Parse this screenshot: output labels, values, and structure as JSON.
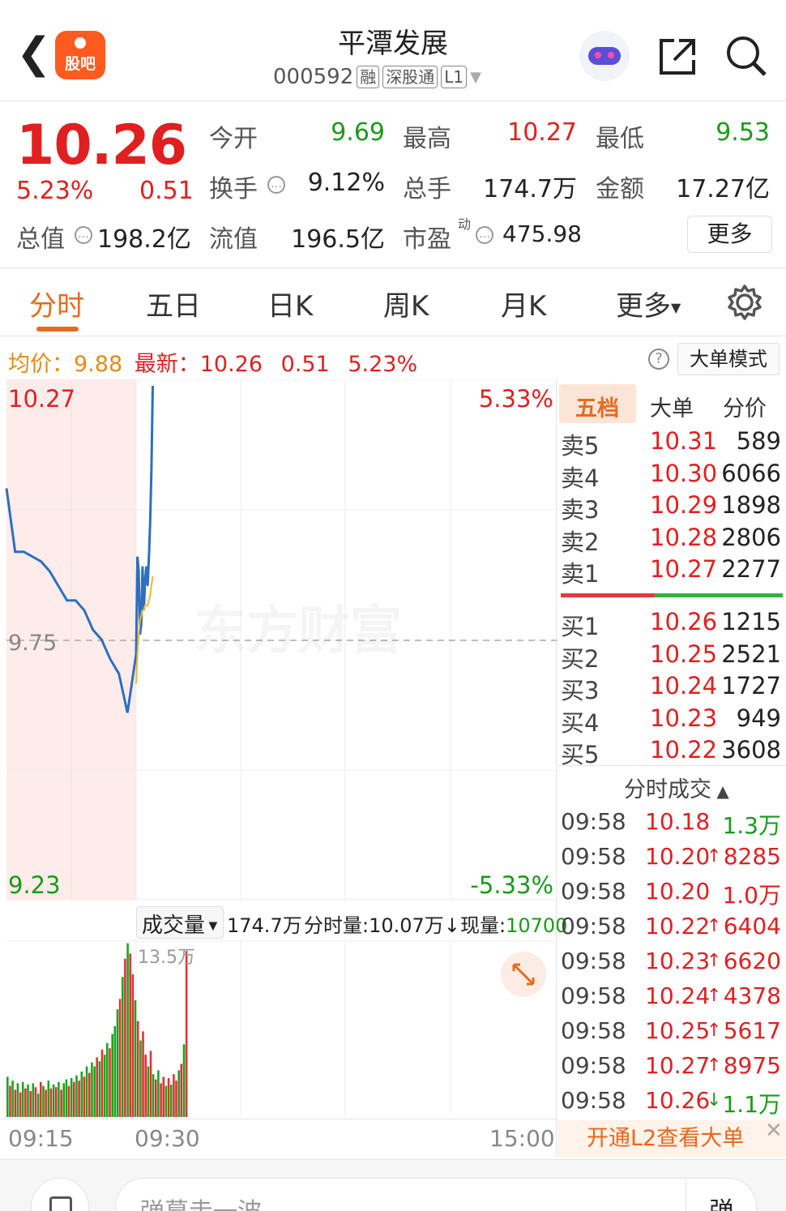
{
  "header": {
    "back_icon": "chevron-left-icon",
    "guba_label": "股吧",
    "stock_name": "平潭发展",
    "stock_code": "000592",
    "tags": [
      "融",
      "深股通",
      "L1"
    ],
    "share_icon": "share-icon",
    "search_icon": "search-icon"
  },
  "quote": {
    "price": "10.26",
    "change_pct": "5.23%",
    "change": "0.51",
    "open_label": "今开",
    "open": "9.69",
    "high_label": "最高",
    "high": "10.27",
    "low_label": "最低",
    "low": "9.53",
    "turnover_label": "换手",
    "turnover": "9.12%",
    "volume_label": "总手",
    "volume": "174.7万",
    "amount_label": "金额",
    "amount": "17.27亿",
    "mcap_label": "总值",
    "mcap": "198.2亿",
    "float_label": "流值",
    "float": "196.5亿",
    "pe_label": "市盈",
    "pe_sup": "动",
    "pe": "475.98",
    "more_label": "更多"
  },
  "tabs": [
    "分时",
    "五日",
    "日K",
    "周K",
    "月K",
    "更多"
  ],
  "info_line": {
    "avg_label": "均价：",
    "avg": "9.88",
    "latest_label": "最新：",
    "latest": "10.26",
    "latest_chg": "0.51",
    "latest_pct": "5.23%",
    "big_order_mode": "大单模式"
  },
  "chart_data": [
    {
      "type": "line",
      "title": "",
      "y_high_label": "10.27",
      "y_low_label": "9.23",
      "y_mid_label": "9.75",
      "pct_high_label": "5.33%",
      "pct_low_label": "-5.33%",
      "ylim": [
        9.23,
        10.27
      ],
      "x_labels": [
        "09:15",
        "09:30",
        "15:00"
      ],
      "watermark": "东方财富",
      "series": [
        {
          "color": "#2f6fbd",
          "x": [
            "09:15",
            "09:16",
            "09:17",
            "09:18",
            "09:19",
            "09:20",
            "09:21",
            "09:22",
            "09:23",
            "09:24",
            "09:25",
            "09:26",
            "09:27",
            "09:28",
            "09:29",
            "09:30",
            "09:31",
            "09:32",
            "09:33",
            "09:34",
            "09:35",
            "09:36",
            "09:37",
            "09:38",
            "09:39",
            "09:40",
            "09:41",
            "09:42",
            "09:43"
          ],
          "values": [
            10.06,
            9.93,
            9.93,
            9.92,
            9.91,
            9.89,
            9.86,
            9.83,
            9.83,
            9.81,
            9.77,
            9.75,
            9.71,
            9.68,
            9.6,
            9.72,
            9.92,
            9.89,
            9.76,
            9.78,
            9.9,
            9.81,
            9.87,
            9.9,
            9.86,
            9.92,
            9.99,
            10.1,
            10.27
          ]
        },
        {
          "color": "#f0b830",
          "x": [
            "09:30",
            "09:31",
            "09:32",
            "09:33",
            "09:34",
            "09:35",
            "09:36",
            "09:37",
            "09:38",
            "09:39",
            "09:40",
            "09:41",
            "09:42",
            "09:43"
          ],
          "values": [
            9.66,
            9.72,
            9.76,
            9.79,
            9.8,
            9.81,
            9.81,
            9.82,
            9.82,
            9.82,
            9.83,
            9.84,
            9.86,
            9.88
          ]
        }
      ]
    },
    {
      "type": "bar",
      "title": "",
      "volume_label": "成交量",
      "volume_total": "174.7万",
      "minute_volume_label": "分时量:",
      "minute_volume": "10.07万",
      "current_label": "现量:",
      "current": "10700",
      "max_label": "13.5万",
      "ylim": [
        0,
        13.5
      ],
      "values": [
        3.1,
        2.4,
        2.8,
        2.1,
        2.6,
        1.9,
        2.7,
        2.2,
        2.5,
        2.0,
        2.6,
        2.3,
        1.8,
        2.7,
        2.4,
        2.1,
        2.8,
        2.2,
        2.5,
        2.3,
        2.7,
        2.1,
        2.6,
        2.9,
        2.4,
        3.0,
        2.7,
        3.2,
        2.8,
        3.5,
        3.1,
        3.9,
        3.4,
        4.2,
        3.9,
        4.6,
        4.3,
        5.2,
        4.8,
        5.7,
        5.3,
        6.4,
        7.0,
        8.3,
        9.1,
        10.8,
        12.2,
        13.4,
        12.6,
        11.0,
        9.0,
        7.4,
        5.9,
        6.6,
        4.8,
        3.9,
        5.1,
        3.3,
        2.9,
        3.6,
        2.6,
        3.1,
        2.4,
        3.0,
        2.5,
        3.3,
        2.8,
        3.6,
        4.1,
        5.6,
        12.8
      ],
      "colors": [
        "g",
        "r",
        "g",
        "r",
        "g",
        "r",
        "g",
        "r",
        "g",
        "r",
        "g",
        "r",
        "g",
        "r",
        "g",
        "r",
        "g",
        "r",
        "g",
        "r",
        "g",
        "r",
        "g",
        "g",
        "r",
        "g",
        "r",
        "g",
        "r",
        "g",
        "r",
        "g",
        "r",
        "g",
        "g",
        "r",
        "g",
        "r",
        "g",
        "g",
        "r",
        "g",
        "g",
        "g",
        "r",
        "g",
        "r",
        "g",
        "r",
        "r",
        "g",
        "r",
        "g",
        "r",
        "r",
        "g",
        "r",
        "g",
        "r",
        "g",
        "r",
        "r",
        "g",
        "r",
        "g",
        "r",
        "r",
        "g",
        "r",
        "g",
        "r"
      ]
    }
  ],
  "orderbook": {
    "tabs": [
      "五档",
      "大单",
      "分价"
    ],
    "asks": [
      {
        "label": "卖5",
        "price": "10.31",
        "vol": "589"
      },
      {
        "label": "卖4",
        "price": "10.30",
        "vol": "6066"
      },
      {
        "label": "卖3",
        "price": "10.29",
        "vol": "1898"
      },
      {
        "label": "卖2",
        "price": "10.28",
        "vol": "2806"
      },
      {
        "label": "卖1",
        "price": "10.27",
        "vol": "2277"
      }
    ],
    "bids": [
      {
        "label": "买1",
        "price": "10.26",
        "vol": "1215"
      },
      {
        "label": "买2",
        "price": "10.25",
        "vol": "2521"
      },
      {
        "label": "买3",
        "price": "10.24",
        "vol": "1727"
      },
      {
        "label": "买4",
        "price": "10.23",
        "vol": "949"
      },
      {
        "label": "买5",
        "price": "10.22",
        "vol": "3608"
      }
    ]
  },
  "ticks": {
    "title": "分时成交",
    "rows": [
      {
        "time": "09:58",
        "price": "10.18",
        "arrow": "",
        "vol": "1.3万",
        "color": "green"
      },
      {
        "time": "09:58",
        "price": "10.20",
        "arrow": "↑",
        "vol": "8285",
        "color": "red"
      },
      {
        "time": "09:58",
        "price": "10.20",
        "arrow": "",
        "vol": "1.0万",
        "color": "red"
      },
      {
        "time": "09:58",
        "price": "10.22",
        "arrow": "↑",
        "vol": "6404",
        "color": "red"
      },
      {
        "time": "09:58",
        "price": "10.23",
        "arrow": "↑",
        "vol": "6620",
        "color": "red"
      },
      {
        "time": "09:58",
        "price": "10.24",
        "arrow": "↑",
        "vol": "4378",
        "color": "red"
      },
      {
        "time": "09:58",
        "price": "10.25",
        "arrow": "↑",
        "vol": "5617",
        "color": "red"
      },
      {
        "time": "09:58",
        "price": "10.27",
        "arrow": "↑",
        "vol": "8975",
        "color": "red"
      },
      {
        "time": "09:58",
        "price": "10.26",
        "arrow": "↓",
        "vol": "1.1万",
        "color": "green"
      }
    ]
  },
  "l2_banner": "开通L2查看大单",
  "bottom": {
    "comment_placeholder": "弹幕走一波",
    "danmu_label": "弹"
  }
}
